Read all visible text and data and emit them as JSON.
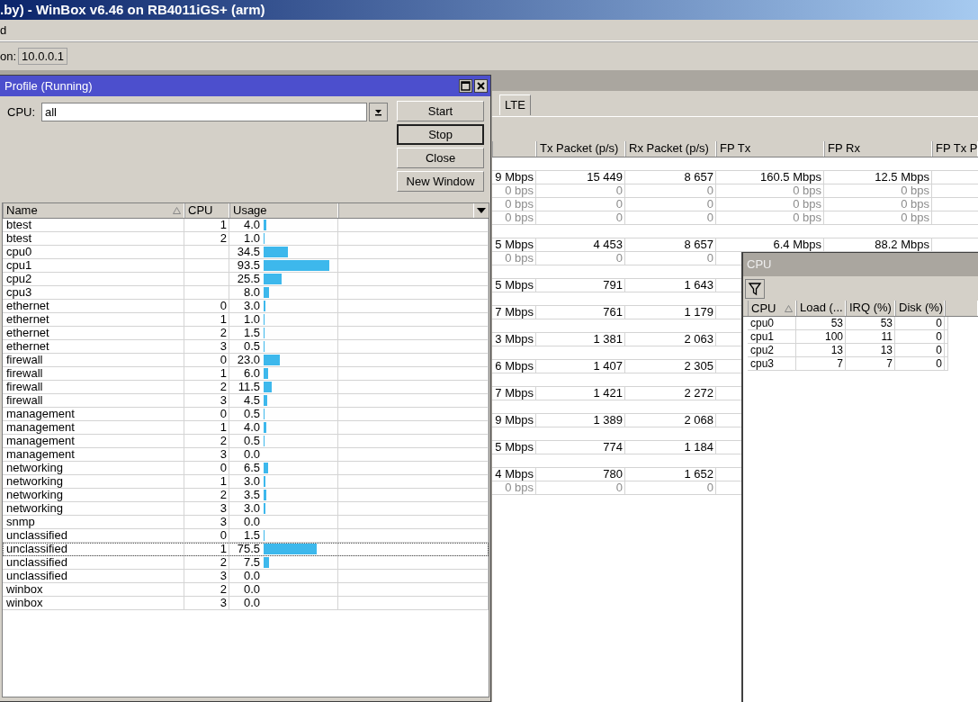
{
  "app_title": ".by) - WinBox v6.46 on RB4011iGS+ (arm)",
  "menu": [
    "d"
  ],
  "toolbar": {
    "label": "on:",
    "value": "10.0.0.1"
  },
  "interface_window": {
    "tabs": [
      {
        "label": "LTE"
      }
    ],
    "columns": [
      "Tx Packet (p/s)",
      "Rx Packet (p/s)",
      "FP Tx",
      "FP Rx",
      "FP Tx P"
    ],
    "rows": [
      {
        "kind": "gap"
      },
      {
        "kind": "data",
        "inactive": false,
        "cells": [
          "9 Mbps",
          "15 449",
          "8 657",
          "160.5 Mbps",
          "12.5 Mbps"
        ]
      },
      {
        "kind": "data",
        "inactive": true,
        "cells": [
          "0 bps",
          "0",
          "0",
          "0 bps",
          "0 bps"
        ]
      },
      {
        "kind": "data",
        "inactive": true,
        "cells": [
          "0 bps",
          "0",
          "0",
          "0 bps",
          "0 bps"
        ]
      },
      {
        "kind": "data",
        "inactive": true,
        "cells": [
          "0 bps",
          "0",
          "0",
          "0 bps",
          "0 bps"
        ]
      },
      {
        "kind": "gap"
      },
      {
        "kind": "data",
        "inactive": false,
        "cells": [
          "5 Mbps",
          "4 453",
          "8 657",
          "6.4 Mbps",
          "88.2 Mbps"
        ]
      },
      {
        "kind": "data",
        "inactive": true,
        "cells": [
          "0 bps",
          "0",
          "0"
        ]
      },
      {
        "kind": "gap"
      },
      {
        "kind": "data",
        "inactive": false,
        "cells": [
          "5 Mbps",
          "791",
          "1 643"
        ]
      },
      {
        "kind": "gap"
      },
      {
        "kind": "data",
        "inactive": false,
        "cells": [
          "7 Mbps",
          "761",
          "1 179"
        ]
      },
      {
        "kind": "gap"
      },
      {
        "kind": "data",
        "inactive": false,
        "cells": [
          "3 Mbps",
          "1 381",
          "2 063"
        ]
      },
      {
        "kind": "gap"
      },
      {
        "kind": "data",
        "inactive": false,
        "cells": [
          "6 Mbps",
          "1 407",
          "2 305"
        ]
      },
      {
        "kind": "gap"
      },
      {
        "kind": "data",
        "inactive": false,
        "cells": [
          "7 Mbps",
          "1 421",
          "2 272"
        ]
      },
      {
        "kind": "gap"
      },
      {
        "kind": "data",
        "inactive": false,
        "cells": [
          "9 Mbps",
          "1 389",
          "2 068"
        ]
      },
      {
        "kind": "gap"
      },
      {
        "kind": "data",
        "inactive": false,
        "cells": [
          "5 Mbps",
          "774",
          "1 184"
        ]
      },
      {
        "kind": "gap"
      },
      {
        "kind": "data",
        "inactive": false,
        "cells": [
          "4 Mbps",
          "780",
          "1 652"
        ]
      },
      {
        "kind": "data",
        "inactive": true,
        "cells": [
          "0 bps",
          "0",
          "0"
        ]
      }
    ]
  },
  "profile_window": {
    "title": "Profile (Running)",
    "cpu_label": "CPU:",
    "cpu_value": "all",
    "buttons": [
      {
        "label": "Start",
        "focused": false
      },
      {
        "label": "Stop",
        "focused": true
      },
      {
        "label": "Close",
        "focused": false
      },
      {
        "label": "New Window",
        "focused": false
      }
    ],
    "columns": [
      "Name",
      "CPU",
      "Usage"
    ],
    "rows": [
      {
        "name": "btest",
        "cpu": "1",
        "usage": "4.0",
        "level": 0.04,
        "selected": false
      },
      {
        "name": "btest",
        "cpu": "2",
        "usage": "1.0",
        "level": 0.01,
        "selected": false
      },
      {
        "name": "cpu0",
        "usage": "34.5",
        "level": 0.345,
        "selected": false
      },
      {
        "name": "cpu1",
        "usage": "93.5",
        "level": 0.935,
        "selected": false
      },
      {
        "name": "cpu2",
        "usage": "25.5",
        "level": 0.255,
        "selected": false
      },
      {
        "name": "cpu3",
        "usage": "8.0",
        "level": 0.08,
        "selected": false
      },
      {
        "name": "ethernet",
        "cpu": "0",
        "usage": "3.0",
        "level": 0.03,
        "selected": false
      },
      {
        "name": "ethernet",
        "cpu": "1",
        "usage": "1.0",
        "level": 0.01,
        "selected": false
      },
      {
        "name": "ethernet",
        "cpu": "2",
        "usage": "1.5",
        "level": 0.015,
        "selected": false
      },
      {
        "name": "ethernet",
        "cpu": "3",
        "usage": "0.5",
        "level": 0.005,
        "selected": false
      },
      {
        "name": "firewall",
        "cpu": "0",
        "usage": "23.0",
        "level": 0.23,
        "selected": false
      },
      {
        "name": "firewall",
        "cpu": "1",
        "usage": "6.0",
        "level": 0.06,
        "selected": false
      },
      {
        "name": "firewall",
        "cpu": "2",
        "usage": "11.5",
        "level": 0.115,
        "selected": false
      },
      {
        "name": "firewall",
        "cpu": "3",
        "usage": "4.5",
        "level": 0.045,
        "selected": false
      },
      {
        "name": "management",
        "cpu": "0",
        "usage": "0.5",
        "level": 0.005,
        "selected": false
      },
      {
        "name": "management",
        "cpu": "1",
        "usage": "4.0",
        "level": 0.04,
        "selected": false
      },
      {
        "name": "management",
        "cpu": "2",
        "usage": "0.5",
        "level": 0.005,
        "selected": false
      },
      {
        "name": "management",
        "cpu": "3",
        "usage": "0.0",
        "selected": false
      },
      {
        "name": "networking",
        "cpu": "0",
        "usage": "6.5",
        "level": 0.065,
        "selected": false
      },
      {
        "name": "networking",
        "cpu": "1",
        "usage": "3.0",
        "level": 0.03,
        "selected": false
      },
      {
        "name": "networking",
        "cpu": "2",
        "usage": "3.5",
        "level": 0.035,
        "selected": false
      },
      {
        "name": "networking",
        "cpu": "3",
        "usage": "3.0",
        "level": 0.03,
        "selected": false
      },
      {
        "name": "snmp",
        "cpu": "3",
        "usage": "0.0",
        "selected": false
      },
      {
        "name": "unclassified",
        "cpu": "0",
        "usage": "1.5",
        "level": 0.015,
        "selected": false
      },
      {
        "name": "unclassified",
        "cpu": "1",
        "usage": "75.5",
        "level": 0.755,
        "selected": true
      },
      {
        "name": "unclassified",
        "cpu": "2",
        "usage": "7.5",
        "level": 0.075,
        "selected": false
      },
      {
        "name": "unclassified",
        "cpu": "3",
        "usage": "0.0",
        "selected": false
      },
      {
        "name": "winbox",
        "cpu": "2",
        "usage": "0.0",
        "selected": false
      },
      {
        "name": "winbox",
        "cpu": "3",
        "usage": "0.0",
        "selected": false
      }
    ]
  },
  "cpu_window": {
    "title": "CPU",
    "columns": [
      "CPU",
      "Load (...",
      "IRQ (%)",
      "Disk (%)"
    ],
    "rows": [
      [
        "cpu0",
        "53",
        "53",
        "0"
      ],
      [
        "cpu1",
        "100",
        "11",
        "0"
      ],
      [
        "cpu2",
        "13",
        "13",
        "0"
      ],
      [
        "cpu3",
        "7",
        "7",
        "0"
      ]
    ]
  }
}
